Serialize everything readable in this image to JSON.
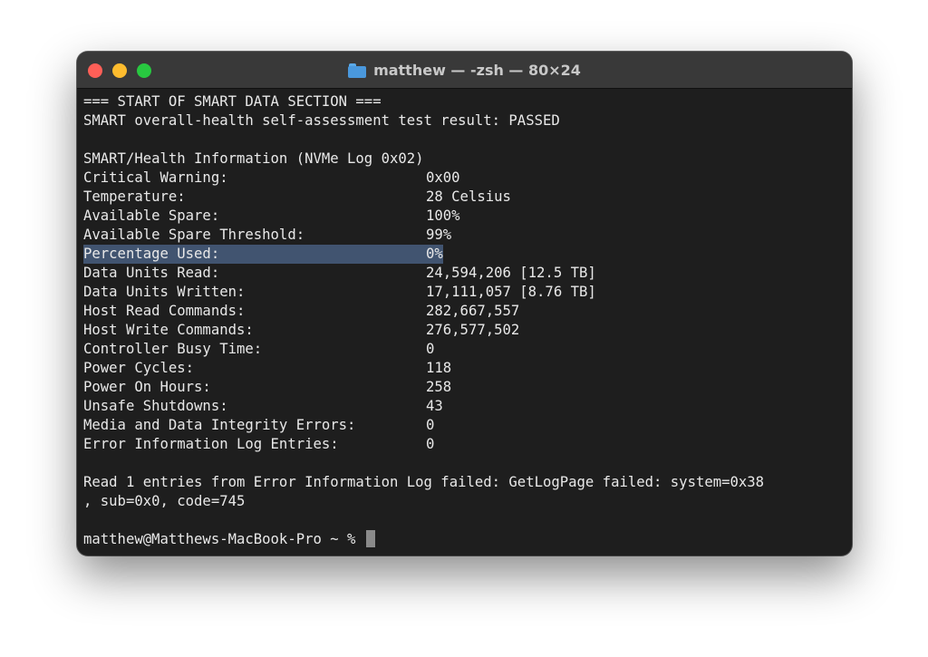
{
  "window": {
    "title": "matthew — -zsh — 80×24",
    "folder_icon": "folder-icon"
  },
  "output": {
    "header": "=== START OF SMART DATA SECTION ===",
    "overall_health": "SMART overall-health self-assessment test result: PASSED",
    "section_title": "SMART/Health Information (NVMe Log 0x02)",
    "rows": [
      {
        "label": "Critical Warning:",
        "value": "0x00"
      },
      {
        "label": "Temperature:",
        "value": "28 Celsius"
      },
      {
        "label": "Available Spare:",
        "value": "100%"
      },
      {
        "label": "Available Spare Threshold:",
        "value": "99%"
      },
      {
        "label": "Percentage Used:",
        "value": "0%"
      },
      {
        "label": "Data Units Read:",
        "value": "24,594,206 [12.5 TB]"
      },
      {
        "label": "Data Units Written:",
        "value": "17,111,057 [8.76 TB]"
      },
      {
        "label": "Host Read Commands:",
        "value": "282,667,557"
      },
      {
        "label": "Host Write Commands:",
        "value": "276,577,502"
      },
      {
        "label": "Controller Busy Time:",
        "value": "0"
      },
      {
        "label": "Power Cycles:",
        "value": "118"
      },
      {
        "label": "Power On Hours:",
        "value": "258"
      },
      {
        "label": "Unsafe Shutdowns:",
        "value": "43"
      },
      {
        "label": "Media and Data Integrity Errors:",
        "value": "0"
      },
      {
        "label": "Error Information Log Entries:",
        "value": "0"
      }
    ],
    "error_line_1": "Read 1 entries from Error Information Log failed: GetLogPage failed: system=0x38",
    "error_line_2": ", sub=0x0, code=745",
    "prompt": "matthew@Matthews-MacBook-Pro ~ % "
  }
}
